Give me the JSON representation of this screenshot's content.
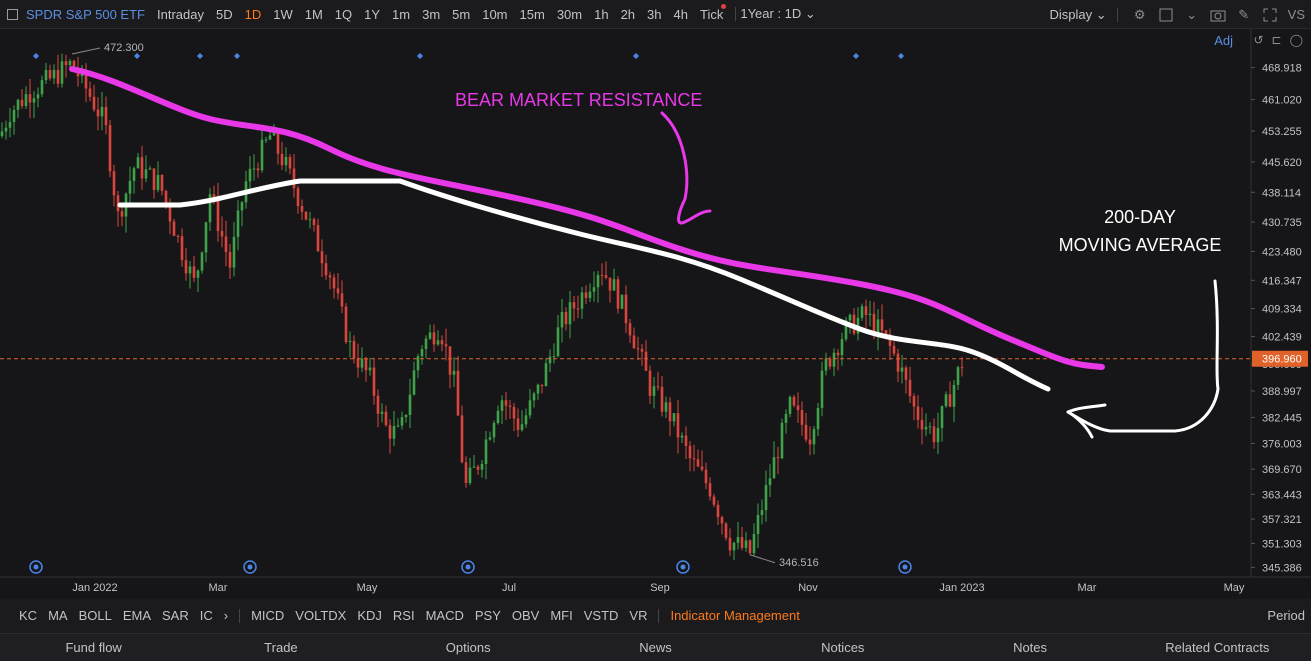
{
  "toolbar": {
    "symbol": "SPDR S&P 500 ETF",
    "timeframes": [
      "Intraday",
      "5D",
      "1D",
      "1W",
      "1M",
      "1Q",
      "1Y",
      "1m",
      "3m",
      "5m",
      "10m",
      "15m",
      "30m",
      "1h",
      "2h",
      "3h",
      "4h",
      "Tick"
    ],
    "active_timeframe": "1D",
    "range": "1Year : 1D",
    "display": "Display",
    "vs": "VS"
  },
  "adj_label": "Adj",
  "annotations": {
    "bear": "BEAR MARKET RESISTANCE",
    "ma_line1": "200-DAY",
    "ma_line2": "MOVING AVERAGE"
  },
  "colors": {
    "up": "#3fa24a",
    "down": "#d9453d",
    "bear_line": "#e838e8",
    "ma_line": "#ffffff",
    "accent": "#ff7a1a",
    "link": "#5a8fe0",
    "current_price": "#e0622a"
  },
  "chart_data": {
    "type": "candlestick",
    "y_ticks": [
      "468.918",
      "461.020",
      "453.255",
      "445.620",
      "438.114",
      "430.735",
      "423.480",
      "416.347",
      "409.334",
      "402.439",
      "395.660",
      "388.997",
      "382.445",
      "376.003",
      "369.670",
      "363.443",
      "357.321",
      "351.303",
      "345.386"
    ],
    "current_price": "396.960",
    "high_label": "472.300",
    "low_label": "346.516",
    "x_labels": [
      "Jan 2022",
      "Mar",
      "May",
      "Jul",
      "Sep",
      "Nov",
      "Jan 2023",
      "Mar",
      "May"
    ],
    "ylim": [
      343,
      476
    ]
  },
  "indicators": [
    "KC",
    "MA",
    "BOLL",
    "EMA",
    "SAR",
    "IC",
    "MICD",
    "VOLTDX",
    "KDJ",
    "RSI",
    "MACD",
    "PSY",
    "OBV",
    "MFI",
    "VSTD",
    "VR"
  ],
  "indicator_mgmt": "Indicator Management",
  "period": "Period",
  "bottom_tabs": [
    "Fund flow",
    "Trade",
    "Options",
    "News",
    "Notices",
    "Notes",
    "Related Contracts"
  ]
}
